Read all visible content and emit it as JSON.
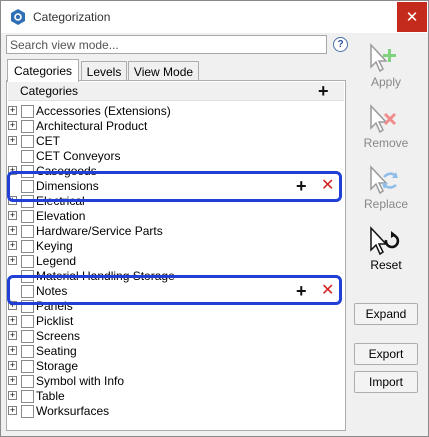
{
  "window": {
    "title": "Categorization",
    "close_glyph": "✕"
  },
  "search": {
    "placeholder": "Search view mode...",
    "value": "",
    "help_glyph": "?"
  },
  "tabs": [
    {
      "label": "Categories",
      "active": true
    },
    {
      "label": "Levels",
      "active": false
    },
    {
      "label": "View Mode",
      "active": false
    }
  ],
  "panel": {
    "header_label": "Categories",
    "header_add_glyph": "+"
  },
  "rows": [
    {
      "label": "Accessories (Extensions)",
      "expandable": true
    },
    {
      "label": "Architectural Product",
      "expandable": true
    },
    {
      "label": "CET",
      "expandable": true
    },
    {
      "label": "CET Conveyors",
      "expandable": false
    },
    {
      "label": "Casegoods",
      "expandable": true
    },
    {
      "label": "Dimensions",
      "expandable": false,
      "hovered": true,
      "add_glyph": "+",
      "remove_glyph": "✕"
    },
    {
      "label": "Electrical",
      "expandable": true
    },
    {
      "label": "Elevation",
      "expandable": true
    },
    {
      "label": "Hardware/Service Parts",
      "expandable": true
    },
    {
      "label": "Keying",
      "expandable": true
    },
    {
      "label": "Legend",
      "expandable": true
    },
    {
      "label": "Material Handling Storage",
      "expandable": false
    },
    {
      "label": "Notes",
      "expandable": false,
      "hovered": true,
      "add_glyph": "+",
      "remove_glyph": "✕"
    },
    {
      "label": "Panels",
      "expandable": true
    },
    {
      "label": "Picklist",
      "expandable": true
    },
    {
      "label": "Screens",
      "expandable": true
    },
    {
      "label": "Seating",
      "expandable": true
    },
    {
      "label": "Storage",
      "expandable": true
    },
    {
      "label": "Symbol with Info",
      "expandable": true
    },
    {
      "label": "Table",
      "expandable": true
    },
    {
      "label": "Worksurfaces",
      "expandable": true
    }
  ],
  "side_actions": {
    "apply": {
      "label": "Apply",
      "enabled": false,
      "icon": "cursor-plus-icon"
    },
    "remove": {
      "label": "Remove",
      "enabled": false,
      "icon": "cursor-x-icon"
    },
    "replace": {
      "label": "Replace",
      "enabled": false,
      "icon": "cursor-swap-icon"
    },
    "reset": {
      "label": "Reset",
      "enabled": true,
      "icon": "cursor-reset-icon"
    }
  },
  "buttons": {
    "expand": "Expand",
    "export": "Export",
    "import": "Import"
  },
  "colors": {
    "highlight": "#1f3fd6",
    "remove_red": "#d22020",
    "close_red": "#c42b1c",
    "apply_green": "#3cb043",
    "replace_blue": "#4a90d9"
  }
}
